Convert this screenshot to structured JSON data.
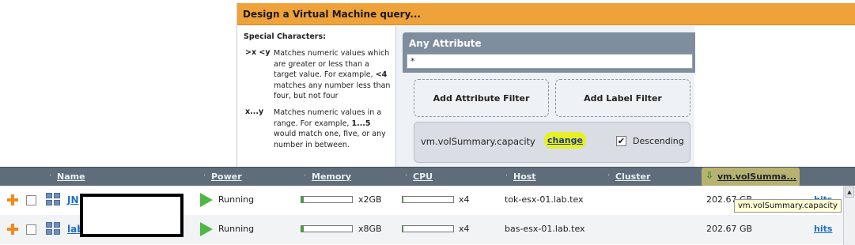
{
  "dialog": {
    "title": "Design a Virtual Machine query...",
    "help_title": "Special Characters:",
    "help_items": [
      {
        "symbol": ">x <y",
        "desc_a": "Matches numeric values which are greater or less than a target value. For example, ",
        "desc_b": "<4",
        "desc_c": " matches any number less than four, but not four"
      },
      {
        "symbol": "x...y",
        "desc_a": "Matches numeric values in a range. For example, ",
        "desc_b": "1...5",
        "desc_c": " would match one, five, or any number in between."
      }
    ],
    "attribute_title": "Any Attribute",
    "attribute_value": "*",
    "add_attribute_filter": "Add Attribute Filter",
    "add_label_filter": "Add Label Filter",
    "sort_field": "vm.volSummary.capacity",
    "sort_change": "change",
    "sort_checkbox": "✔",
    "sort_descending": "Descending"
  },
  "grid": {
    "columns": {
      "name": "Name",
      "power": "Power",
      "memory": "Memory",
      "cpu": "CPU",
      "host": "Host",
      "cluster": "Cluster",
      "sorted": "vm.volSumma...",
      "sort_arrow": "⇩",
      "dot": "·"
    },
    "rows": [
      {
        "name": "JN",
        "power": "Running",
        "memory": "x2GB",
        "memory_fill": 0.05,
        "cpu": "x4",
        "cpu_fill": 0.02,
        "host": "tok-esx-01.lab.tex",
        "capacity": "202.67 GB",
        "hits": "hits"
      },
      {
        "name": "lab",
        "power": "Running",
        "memory": "x8GB",
        "memory_fill": 0.05,
        "cpu": "x4",
        "cpu_fill": 0.02,
        "host": "bas-esx-01.lab.tex",
        "capacity": "202.67 GB",
        "hits": "hits"
      }
    ],
    "tooltip": "vm.volSummary.capacity",
    "scroll_up": "▲"
  }
}
